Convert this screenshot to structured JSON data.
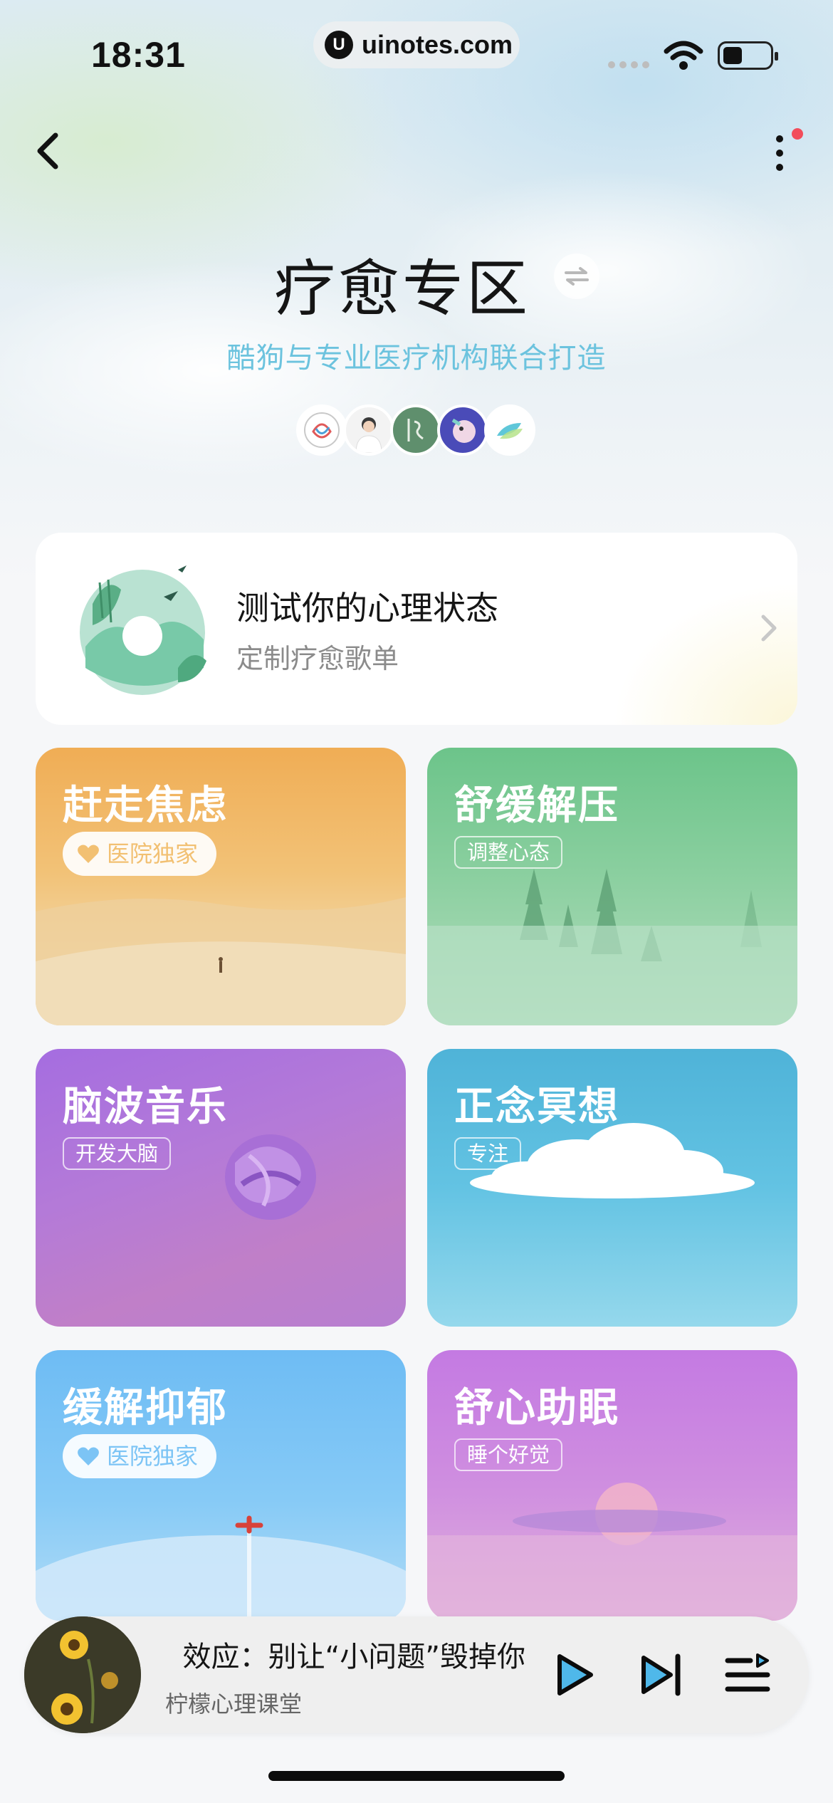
{
  "status_bar": {
    "time": "18:31",
    "url": "uinotes.com",
    "url_logo": "U"
  },
  "nav": {
    "back_icon": "chevron-left-icon",
    "more_icon": "more-vertical-icon"
  },
  "header": {
    "title": "疗愈专区",
    "subtitle": "酷狗与专业医疗机构联合打造",
    "switch_icon": "swap-arrows-icon"
  },
  "quiz_card": {
    "title": "测试你的心理状态",
    "subtitle": "定制疗愈歌单"
  },
  "tiles": [
    {
      "title": "赶走焦虑",
      "tag": "医院独家",
      "tag_style": "pill",
      "tag_color": "#f2c072"
    },
    {
      "title": "舒缓解压",
      "tag": "调整心态",
      "tag_style": "outline"
    },
    {
      "title": "脑波音乐",
      "tag": "开发大脑",
      "tag_style": "outline"
    },
    {
      "title": "正念冥想",
      "tag": "专注",
      "tag_style": "outline"
    },
    {
      "title": "缓解抑郁",
      "tag": "医院独家",
      "tag_style": "pill",
      "tag_color": "#7cc4f5"
    },
    {
      "title": "舒心助眠",
      "tag": "睡个好觉",
      "tag_style": "outline"
    }
  ],
  "player": {
    "title": "效应：别让“小问题”毁掉你",
    "artist": "柠檬心理课堂",
    "controls": [
      "play-icon",
      "next-icon",
      "playlist-icon"
    ]
  },
  "colors": {
    "accent": "#6cc3de",
    "badge": "#f24d5b"
  }
}
